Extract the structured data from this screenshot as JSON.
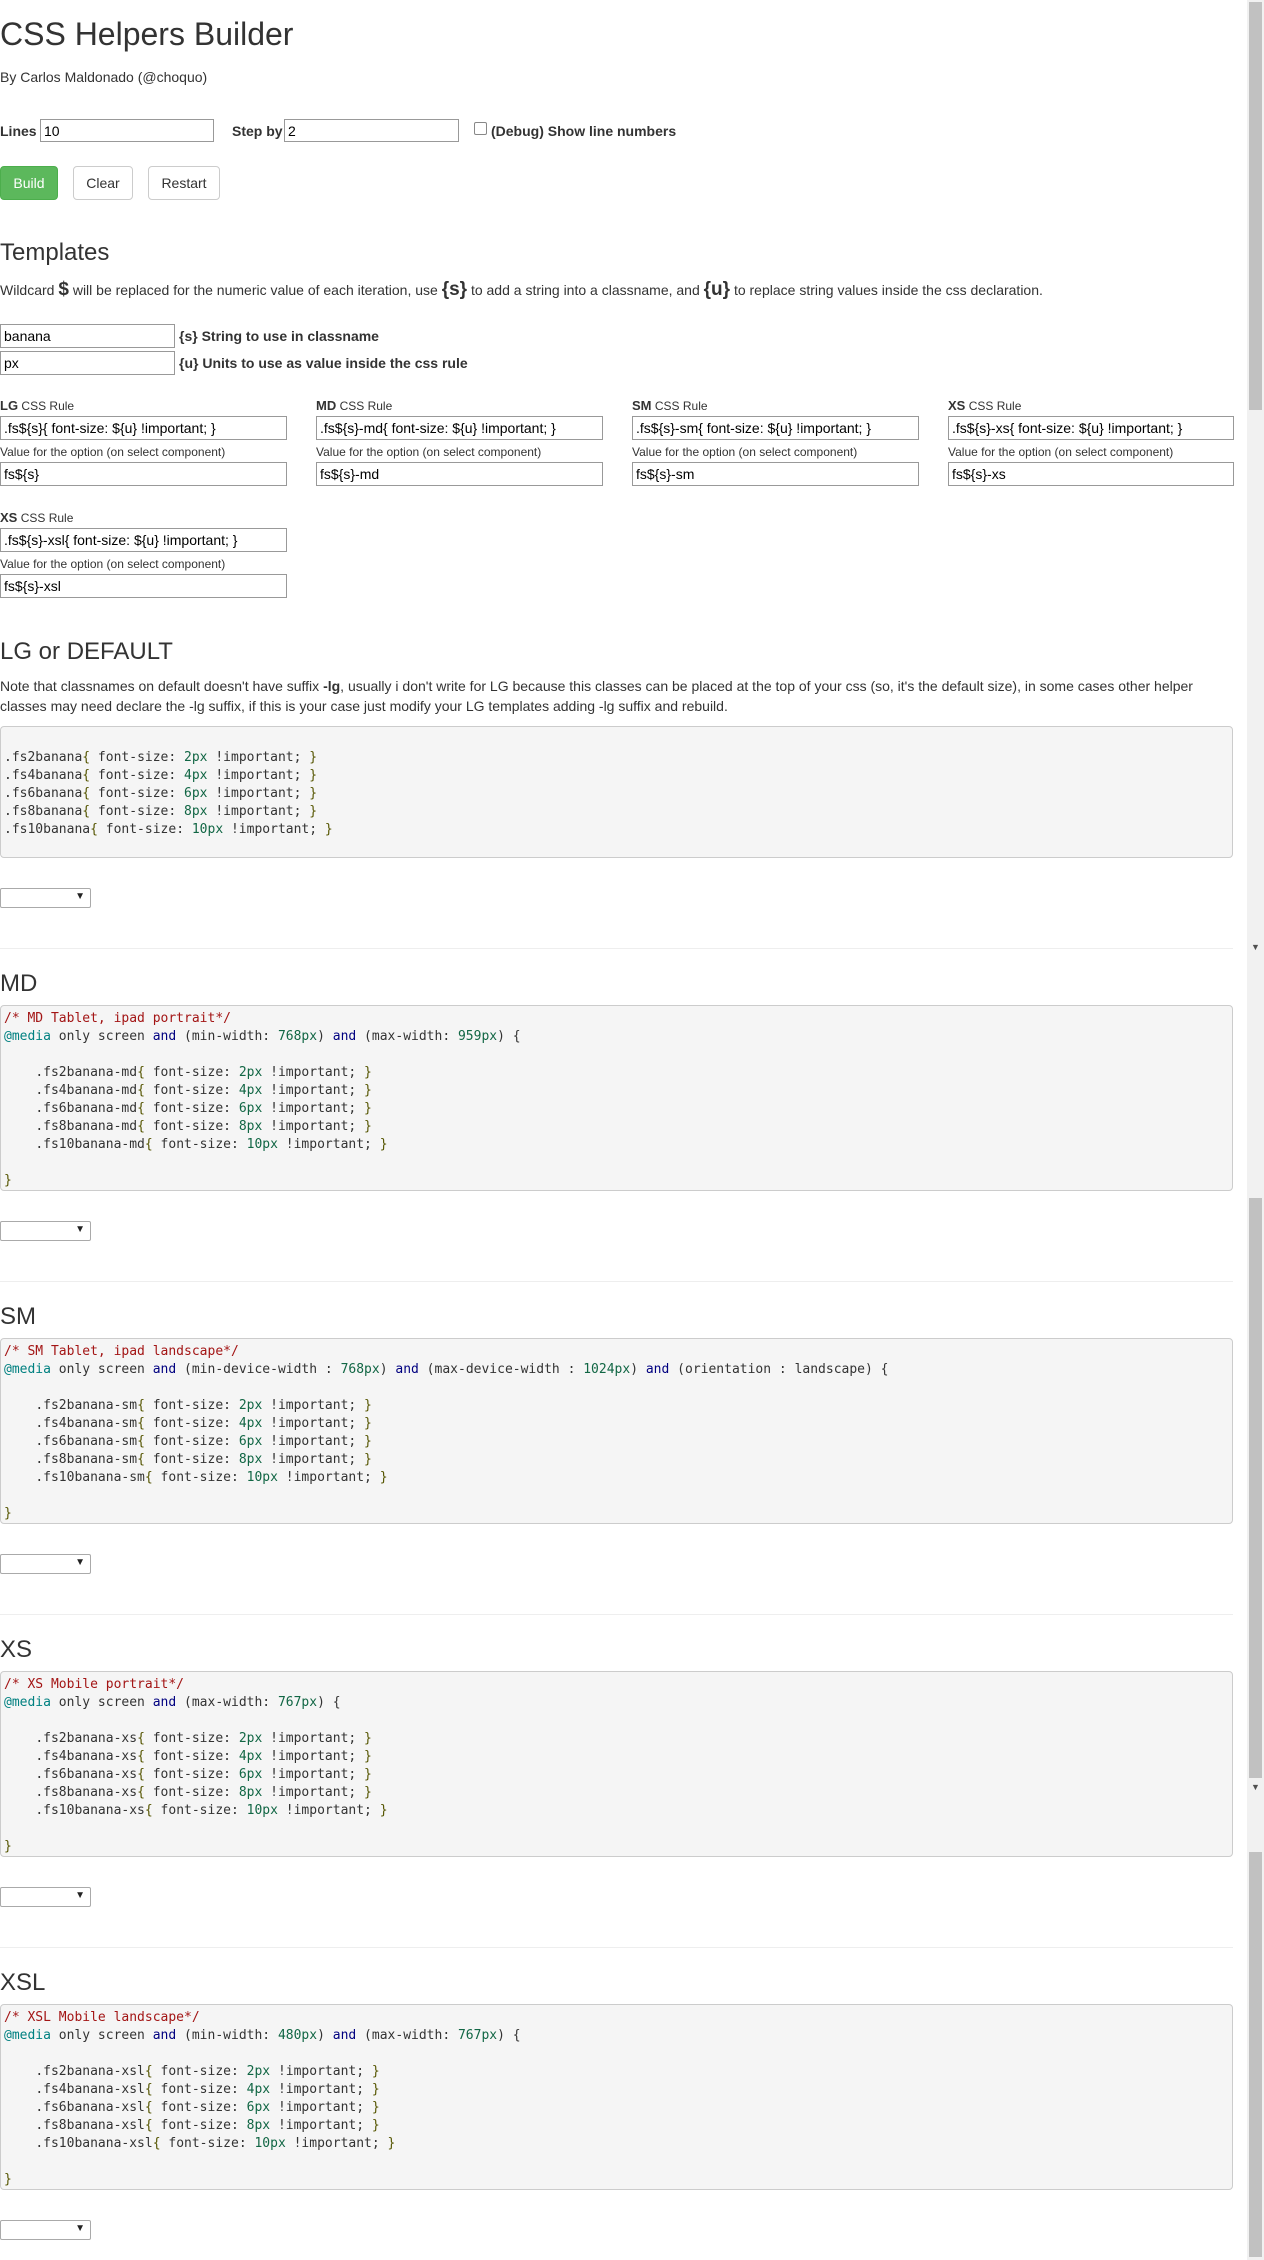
{
  "header": {
    "title": "CSS Helpers Builder",
    "byline": "By Carlos Maldonado (@choquo)"
  },
  "controls": {
    "lines_label": "Lines",
    "lines_value": "10",
    "step_label": "Step by",
    "step_value": "2",
    "debug_label": "(Debug) Show line numbers",
    "build_label": "Build",
    "clear_label": "Clear",
    "restart_label": "Restart"
  },
  "templates": {
    "title": "Templates",
    "desc_1": "Wildcard",
    "desc_dollar": "$",
    "desc_2": "will be replaced for the numeric value of each iteration, use",
    "desc_s": "{s}",
    "desc_3": "to add a string into a classname, and",
    "desc_u": "{u}",
    "desc_4": "to replace string values inside the css declaration.",
    "string_value": "banana",
    "string_label": "{s} String to use in classname",
    "units_value": "px",
    "units_label": "{u} Units to use as value inside the css rule",
    "rule_suffix": "CSS Rule",
    "option_note": "Value for the option (on select component)",
    "rules": [
      {
        "size": "LG",
        "rule": ".fs${s}{ font-size: ${u} !important; }",
        "option": "fs${s}"
      },
      {
        "size": "MD",
        "rule": ".fs${s}-md{ font-size: ${u} !important; }",
        "option": "fs${s}-md"
      },
      {
        "size": "SM",
        "rule": ".fs${s}-sm{ font-size: ${u} !important; }",
        "option": "fs${s}-sm"
      },
      {
        "size": "XS",
        "rule": ".fs${s}-xs{ font-size: ${u} !important; }",
        "option": "fs${s}-xs"
      },
      {
        "size": "XS",
        "rule": ".fs${s}-xsl{ font-size: ${u} !important; }",
        "option": "fs${s}-xsl"
      }
    ]
  },
  "lg": {
    "title": "LG or DEFAULT",
    "note_1": "Note that classnames on default doesn't have suffix",
    "note_bold": "-lg",
    "note_2": ", usually i don't write for LG because this classes can be placed at the top of your css (so, it's the default size), in some cases other helper classes may need declare the -lg suffix, if this is your case just modify your LG templates adding -lg suffix and rebuild."
  },
  "sections": {
    "md": {
      "title": "MD",
      "comment": "/* MD Tablet, ipad portrait*/",
      "suffix": "-md",
      "media": "md"
    },
    "sm": {
      "title": "SM",
      "comment": "/* SM Tablet, ipad landscape*/",
      "suffix": "-sm",
      "media": "sm"
    },
    "xs": {
      "title": "XS",
      "comment": "/* XS Mobile portrait*/",
      "suffix": "-xs",
      "media": "xs"
    },
    "xsl": {
      "title": "XSL",
      "comment": "/* XSL Mobile landscape*/",
      "suffix": "-xsl",
      "media": "xsl"
    }
  },
  "generated": {
    "classname": "banana",
    "unit": "px",
    "values": [
      2,
      4,
      6,
      8,
      10
    ]
  },
  "icons": {
    "select_arrow": "▼",
    "scroll_up": "▲",
    "scroll_down": "▼"
  }
}
